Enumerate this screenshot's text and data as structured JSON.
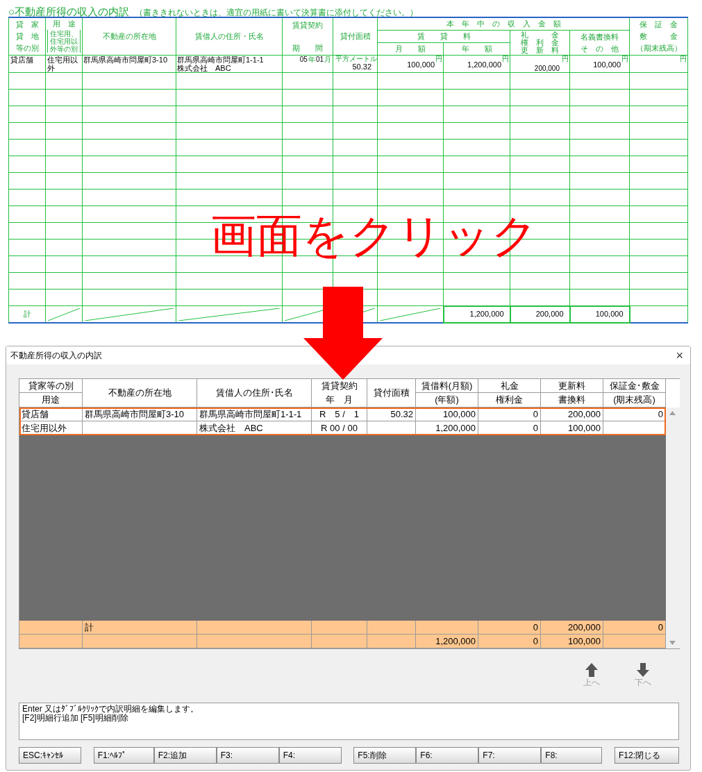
{
  "form": {
    "title": "○不動産所得の収入の内訳",
    "note": "（書ききれないときは、適宜の用紙に書いて決算書に添付してください。）",
    "headers": {
      "type": [
        "貸　家",
        "貸　地",
        "等の別"
      ],
      "usage": "用　途",
      "usage_note": "住宅用、住宅用以外等の別",
      "location": "不動産の所在地",
      "lessee": "賃借人の住所・氏名",
      "period": [
        "賃貸契約",
        "期　　間"
      ],
      "area": "貸付面積",
      "income": "本　年　中　の　収　入　金　額",
      "rent": "賃　　貸　　料",
      "monthly": "月　　額",
      "annual": "年　　額",
      "key_money": [
        "礼　　　金",
        "権　利　金",
        "更　新　料"
      ],
      "name_change": [
        "名義書換料",
        "そ　の　他"
      ],
      "deposit": [
        "保　証　金",
        "敷　　　金",
        "（期末残高）"
      ]
    },
    "rows": [
      {
        "type": "貸店舗",
        "usage": "住宅用以外",
        "location": "群馬県高崎市問屋町3-10",
        "lessee": [
          "群馬県高崎市問屋町1-1-1",
          "株式会社　ABC"
        ],
        "period": {
          "year": "05",
          "year_mark": "年",
          "month": "01",
          "month_mark": "月"
        },
        "area": {
          "unit": "平方メートル",
          "value": "50.32"
        },
        "monthly": {
          "value": "100,000",
          "unit": "円"
        },
        "annual": {
          "value": "1,200,000",
          "unit": "円"
        },
        "key_money": {
          "value": "200,000",
          "unit": "円"
        },
        "name_change": {
          "value": "100,000",
          "unit": "円"
        },
        "deposit": {
          "unit": "円"
        }
      }
    ],
    "total": {
      "label": "計",
      "annual": "1,200,000",
      "key_money": "200,000",
      "name_change": "100,000"
    }
  },
  "overlay": {
    "caption": "画面をクリック"
  },
  "dialog": {
    "title": "不動産所得の収入の内訳",
    "close": "×",
    "columns": [
      {
        "kind": "split",
        "lines": [
          "貸家等の別",
          "用途"
        ]
      },
      {
        "kind": "single",
        "lines": [
          "不動産の所在地"
        ]
      },
      {
        "kind": "single",
        "lines": [
          "賃借人の住所･氏名"
        ]
      },
      {
        "kind": "stacked",
        "lines": [
          "賃貸契約",
          "年　月"
        ]
      },
      {
        "kind": "single",
        "lines": [
          "貸付面積"
        ]
      },
      {
        "kind": "split",
        "lines": [
          "賃借料(月額)",
          "(年額)"
        ]
      },
      {
        "kind": "split",
        "lines": [
          "礼金",
          "権利金"
        ]
      },
      {
        "kind": "split",
        "lines": [
          "更新料",
          "書換料"
        ]
      },
      {
        "kind": "split",
        "lines": [
          "保証金･敷金",
          "(期末残高)"
        ]
      }
    ],
    "records": [
      {
        "selected": true,
        "lines": [
          {
            "type": "貸店舗",
            "location": "群馬県高崎市問屋町3-10",
            "lessee": "群馬県高崎市問屋町1-1-1",
            "contract": "R　5 /　1",
            "area": "50.32",
            "rent": "100,000",
            "key_money": "0",
            "renewal_fee": "200,000",
            "deposit": "0"
          },
          {
            "type": "住宅用以外",
            "lessee": "株式会社　ABC",
            "contract": "R 00 / 00",
            "rent": "1,200,000",
            "key_money": "0",
            "renewal_fee": "100,000"
          }
        ]
      }
    ],
    "totals": [
      {
        "location": "計",
        "key_money": "0",
        "renewal_fee": "200,000",
        "deposit": "0"
      },
      {
        "rent": "1,200,000",
        "key_money": "0",
        "renewal_fee": "100,000"
      }
    ],
    "nav_buttons": [
      {
        "kind": "up",
        "label": "上へ",
        "disabled": true
      },
      {
        "kind": "down",
        "label": "下へ",
        "disabled": true
      }
    ],
    "message": [
      "Enter 又はﾀﾞﾌﾞﾙｸﾘｯｸで内訳明細を編集します。",
      "[F2]明細行追加 [F5]明細削除"
    ],
    "button_groups": [
      [
        "ESC:ｷｬﾝｾﾙ"
      ],
      [
        "F1:ﾍﾙﾌﾟ",
        "F2:追加",
        "F3:",
        "F4:"
      ],
      [
        "F5:削除",
        "F6:",
        "F7:",
        "F8:"
      ],
      [
        "F12:閉じる"
      ]
    ]
  }
}
